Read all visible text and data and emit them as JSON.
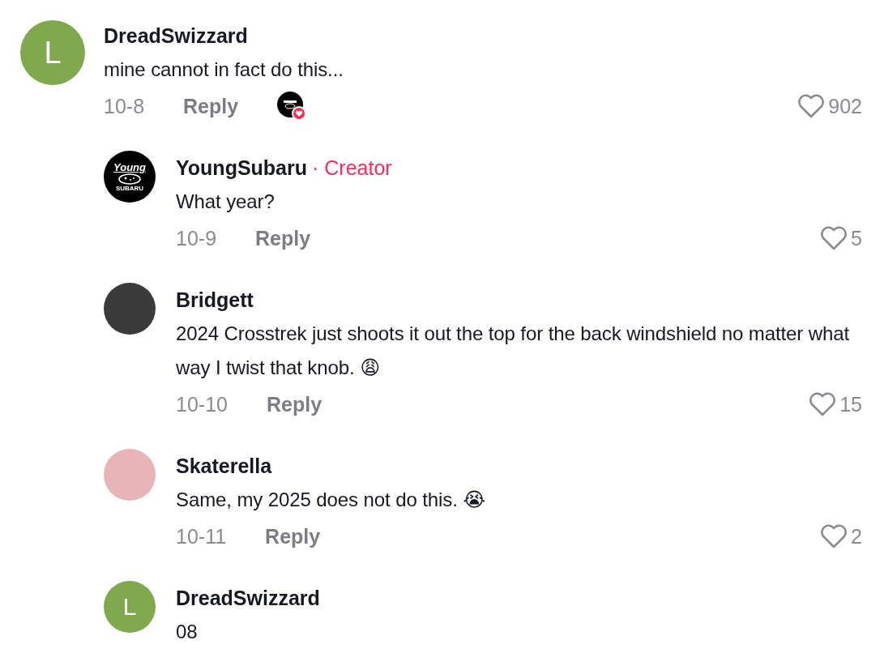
{
  "comments": [
    {
      "avatar": {
        "kind": "letter",
        "letter": "L",
        "color": "#80a84c"
      },
      "username": "DreadSwizzard",
      "text": "mine cannot in fact do this...",
      "date": "10-8",
      "reply": "Reply",
      "creator_liked": true,
      "liked": false,
      "likes": "902",
      "replies": [
        {
          "avatar": {
            "kind": "logo",
            "top": "Young",
            "bottom": "SUBARU"
          },
          "username": "YoungSubaru",
          "badge": "· Creator",
          "text": "What year?",
          "date": "10-9",
          "reply": "Reply",
          "creator_liked": false,
          "liked": false,
          "likes": "5"
        },
        {
          "avatar": {
            "kind": "photo",
            "color": "#3a3a3a"
          },
          "username": "Bridgett",
          "text": "2024 Crosstrek just shoots it out the top for the back windshield no matter what way I twist that knob. 😩",
          "date": "10-10",
          "reply": "Reply",
          "creator_liked": false,
          "liked": false,
          "likes": "15"
        },
        {
          "avatar": {
            "kind": "photo",
            "color": "#e8b4b8"
          },
          "username": "Skaterella",
          "text": "Same, my 2025 does not do this. 😭",
          "date": "10-11",
          "reply": "Reply",
          "creator_liked": false,
          "liked": false,
          "likes": "2"
        },
        {
          "avatar": {
            "kind": "letter",
            "letter": "L",
            "color": "#80a84c"
          },
          "username": "DreadSwizzard",
          "text": "08"
        }
      ]
    }
  ]
}
